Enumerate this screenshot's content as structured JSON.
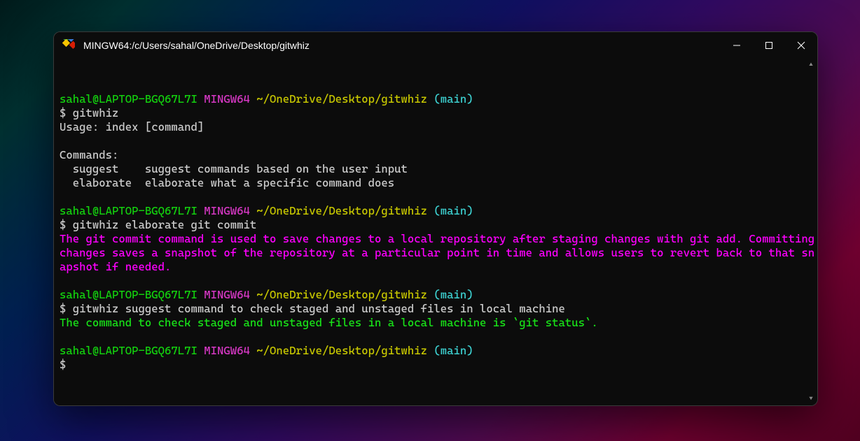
{
  "window": {
    "title": "MINGW64:/c/Users/sahal/OneDrive/Desktop/gitwhiz"
  },
  "prompt": {
    "userhost": "sahal@LAPTOP-BGQ67L7I",
    "env": "MINGW64",
    "path": "~/OneDrive/Desktop/gitwhiz",
    "branch": "(main)",
    "symbol": "$"
  },
  "block1": {
    "cmd": "gitwhiz",
    "usage": "Usage: index [command]",
    "commands_label": "Commands:",
    "cmd_suggest_name": "  suggest   ",
    "cmd_suggest_desc": " suggest commands based on the user input",
    "cmd_elaborate_name": "  elaborate ",
    "cmd_elaborate_desc": " elaborate what a specific command does"
  },
  "block2": {
    "cmd": "gitwhiz elaborate git commit",
    "output": "The git commit command is used to save changes to a local repository after staging changes with git add. Committing changes saves a snapshot of the repository at a particular point in time and allows users to revert back to that snapshot if needed."
  },
  "block3": {
    "cmd": "gitwhiz suggest command to check staged and unstaged files in local machine",
    "output": "The command to check staged and unstaged files in a local machine is `git status`."
  },
  "colors": {
    "green": "#13d10e",
    "magenta": "#d838c6",
    "cyan": "#3dd1d1",
    "yellow": "#c8c800",
    "white": "#cccccc",
    "brightmagenta": "#ff00ff",
    "brightgreen": "#18e218"
  }
}
